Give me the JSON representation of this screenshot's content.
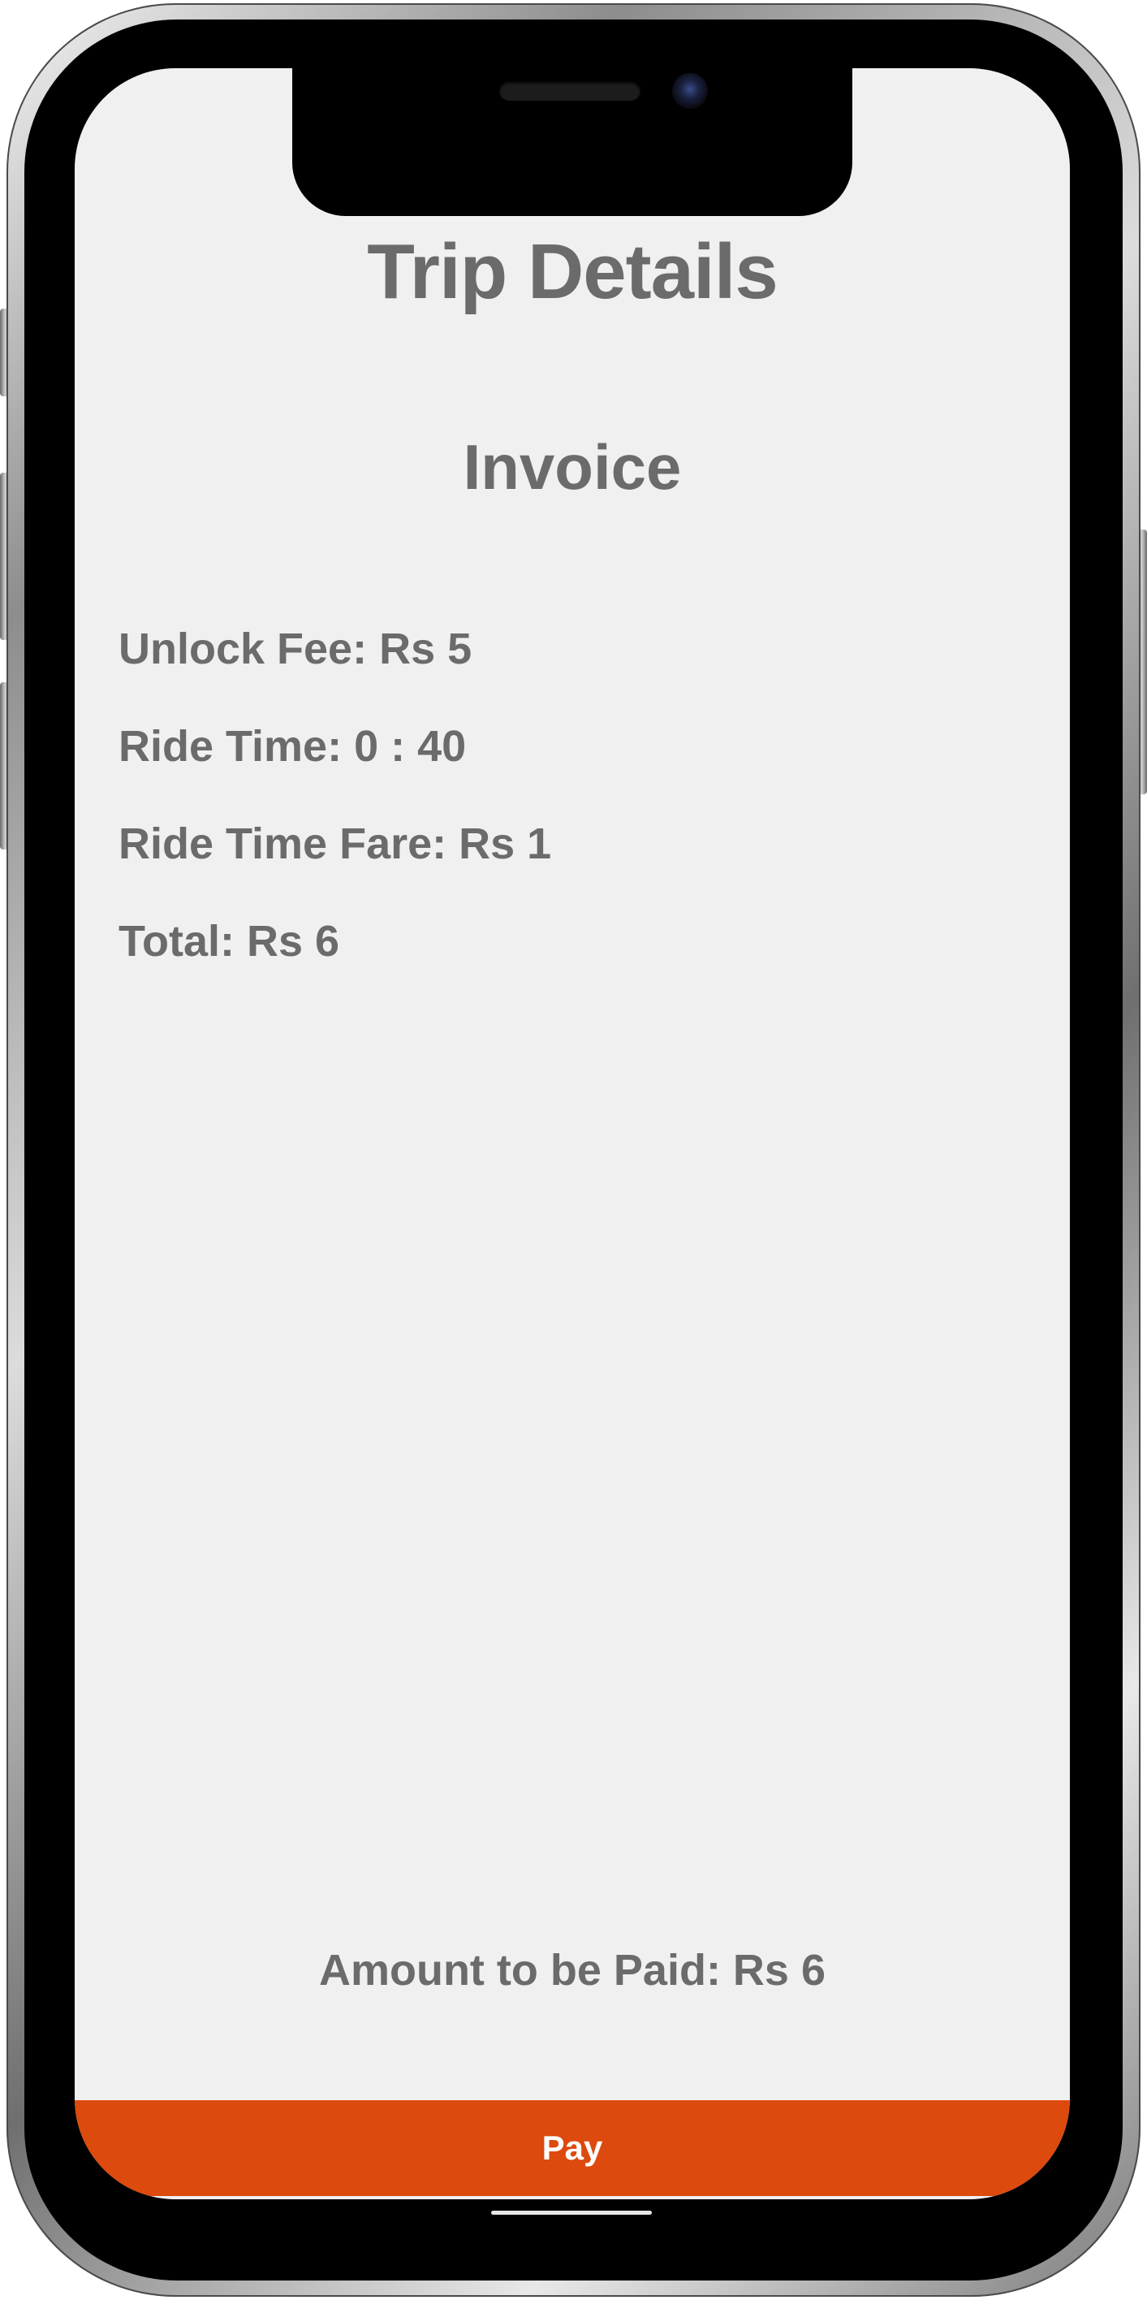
{
  "screen": {
    "title": "Trip Details",
    "section_title": "Invoice",
    "line_items": [
      "Unlock Fee: Rs 5",
      "Ride Time: 0 : 40",
      "Ride Time Fare: Rs 1",
      "Total: Rs 6"
    ],
    "amount_due": "Amount to be Paid: Rs 6",
    "pay_button_label": "Pay"
  },
  "colors": {
    "background": "#f0f0f0",
    "text": "#6b6b6b",
    "accent": "#dc4a0e",
    "button_text": "#ffffff"
  },
  "icons": [
    "front-camera-icon",
    "speaker-grille-icon"
  ]
}
